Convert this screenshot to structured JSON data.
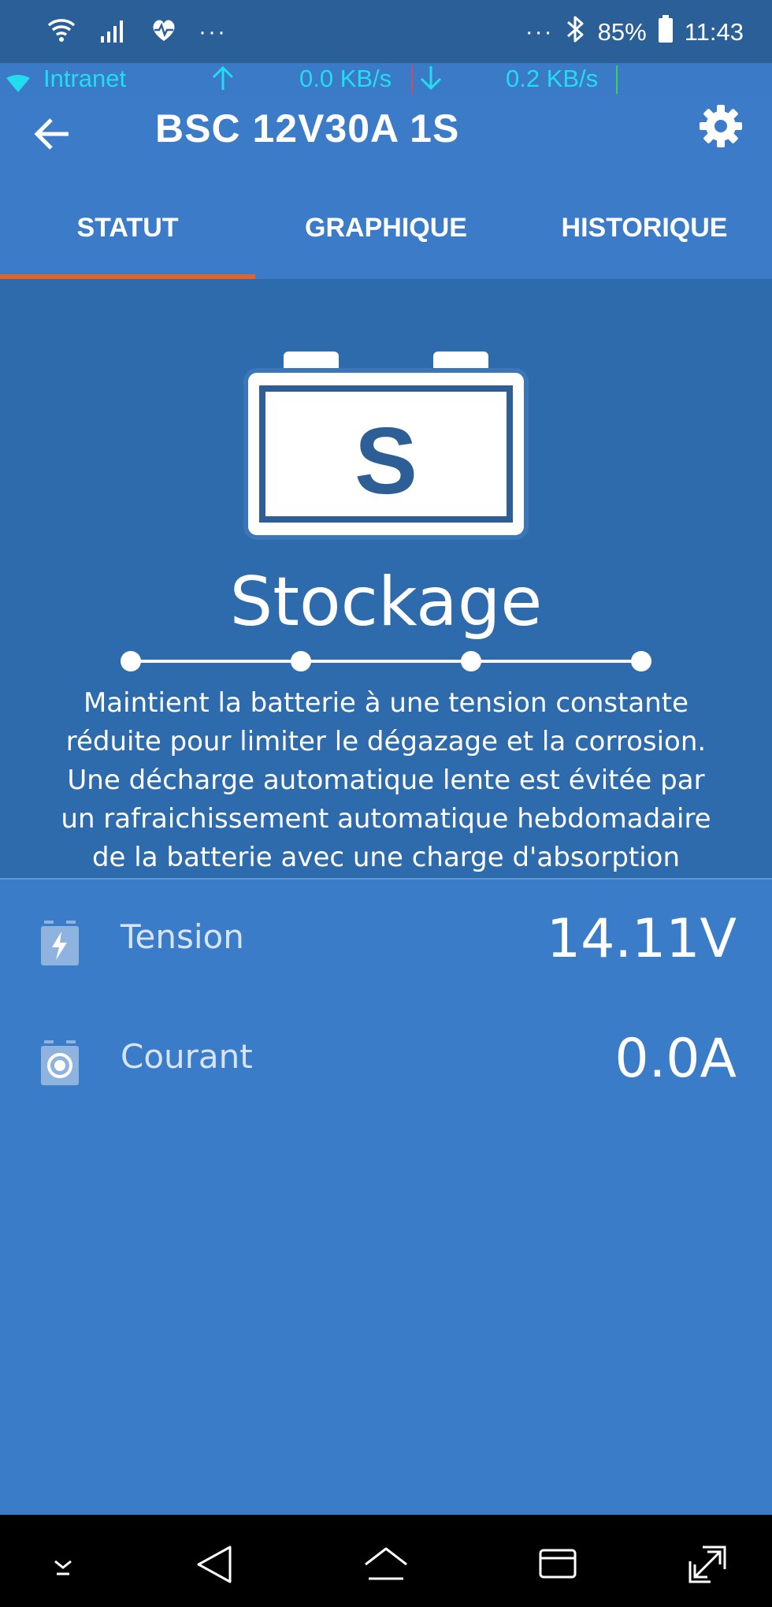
{
  "status_bar": {
    "overflow_left": "···",
    "overflow_right": "···",
    "battery_percent": "85%",
    "time": "11:43"
  },
  "network_bar": {
    "network_name": "Intranet",
    "upload_speed": "0.0 KB/s",
    "download_speed": "0.2 KB/s"
  },
  "header": {
    "title": "BSC 12V30A 1S",
    "tabs": [
      {
        "label": "STATUT",
        "active": true
      },
      {
        "label": "GRAPHIQUE",
        "active": false
      },
      {
        "label": "HISTORIQUE",
        "active": false
      }
    ]
  },
  "charge_state": {
    "icon_letter": "S",
    "name": "Stockage",
    "description": "Maintient la batterie à une tension constante réduite pour limiter le dégazage et la corrosion. Une décharge automatique lente est évitée par un rafraichissement automatique hebdomadaire de la batterie avec une charge d'absorption courte.",
    "progress_steps": 4
  },
  "readings": [
    {
      "label": "Tension",
      "value": "14.11V",
      "icon": "battery-voltage-icon"
    },
    {
      "label": "Courant",
      "value": "0.0A",
      "icon": "battery-current-icon"
    }
  ],
  "colors": {
    "header": "#3b7bc8",
    "state_panel": "#2e6bad",
    "readings_panel": "#3b7cc8",
    "tab_indicator": "#e1642f",
    "net_text": "#22dcf0"
  }
}
